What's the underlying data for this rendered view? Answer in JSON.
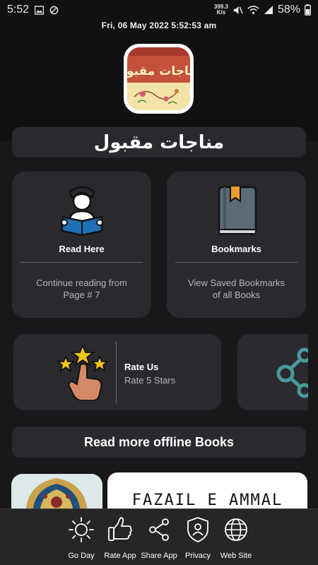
{
  "status_bar": {
    "time": "5:52",
    "net_speed_value": "399.3",
    "net_speed_unit": "K/s",
    "battery": "58%"
  },
  "header": {
    "datetime": "Fri, 06  May  2022   5:52:53 am"
  },
  "app": {
    "title_urdu": "مناجات مقبول",
    "logo_text": "مناجات مقبول"
  },
  "cards": {
    "read": {
      "title": "Read Here",
      "desc_line1": "Continue reading from",
      "desc_line2": "Page # 7"
    },
    "bookmarks": {
      "title": "Bookmarks",
      "desc_line1": "View Saved Bookmarks",
      "desc_line2": "of all Books"
    },
    "rate": {
      "title": "Rate Us",
      "subtitle": "Rate 5 Stars"
    }
  },
  "offline_section": {
    "label": "Read more offline Books"
  },
  "books": [
    {
      "title": "FAZAIL E AMMAL"
    }
  ],
  "bottom_nav": [
    {
      "label": "Go Day",
      "icon": "sun-icon"
    },
    {
      "label": "Rate App",
      "icon": "thumbs-up-icon"
    },
    {
      "label": "Share App",
      "icon": "share-icon"
    },
    {
      "label": "Privacy",
      "icon": "shield-user-icon"
    },
    {
      "label": "Web Site",
      "icon": "globe-icon"
    }
  ],
  "colors": {
    "background": "#111113",
    "card": "#2a2a2e",
    "nav": "#262628",
    "text_secondary": "#b8b8bc",
    "accent_blue": "#1f6fb5",
    "star_yellow": "#f5c518",
    "share_teal": "#4a9aa0"
  }
}
